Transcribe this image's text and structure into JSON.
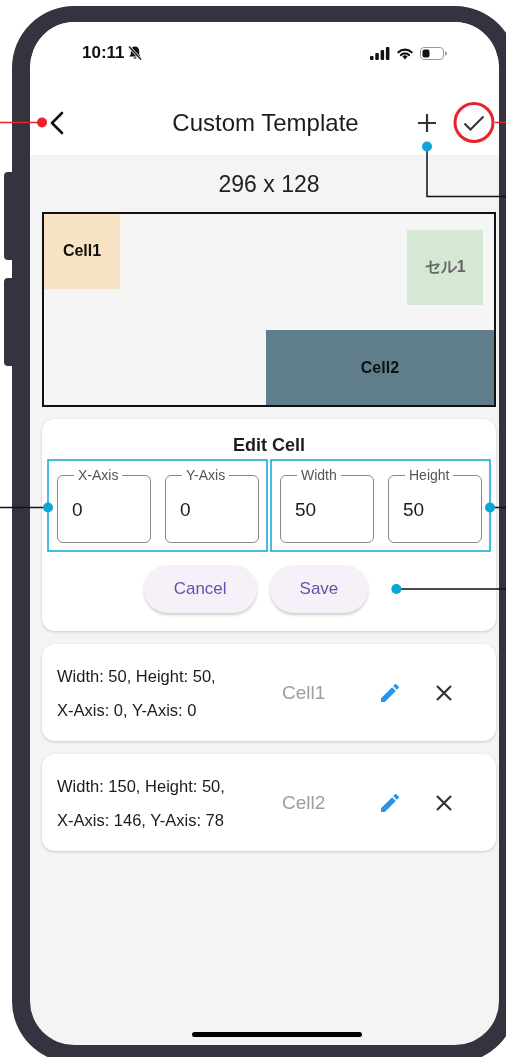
{
  "status_bar": {
    "time": "10:11",
    "silent": true
  },
  "app_bar": {
    "title": "Custom Template",
    "back": {
      "callout": {
        "kind": "dot-left",
        "color": "#e8232b"
      }
    },
    "add": {
      "callout": {
        "kind": "dot-below-elbow",
        "color": "#0ba5d8"
      }
    },
    "done": {
      "callout": {
        "kind": "ring-right",
        "color": "#e8232b"
      }
    }
  },
  "canvas": {
    "size_label": "296 x 128",
    "cells": [
      {
        "label": "Cell1",
        "color": "#f8e3c5"
      },
      {
        "label": "セル1",
        "color": "#d5e8d4"
      },
      {
        "label": "Cell2",
        "color": "#607d8b"
      }
    ]
  },
  "edit_card": {
    "title": "Edit Cell",
    "field_groups": [
      {
        "callout": {
          "kind": "frame-left",
          "color": "#0ba5d8"
        },
        "fields": [
          {
            "label": "X-Axis",
            "value": "0"
          },
          {
            "label": "Y-Axis",
            "value": "0"
          }
        ]
      },
      {
        "callout": {
          "kind": "frame-right",
          "color": "#0ba5d8"
        },
        "fields": [
          {
            "label": "Width",
            "value": "50"
          },
          {
            "label": "Height",
            "value": "50"
          }
        ]
      }
    ],
    "buttons": [
      {
        "label": "Cancel"
      },
      {
        "label": "Save"
      }
    ],
    "actions_callout": {
      "kind": "dot-right",
      "color": "#0ba5d8"
    }
  },
  "cell_list": [
    {
      "details": [
        "Width: 50, Height: 50,",
        "X-Axis: 0, Y-Axis: 0"
      ],
      "name": "Cell1"
    },
    {
      "details": [
        "Width: 150, Height: 50,",
        "X-Axis: 146, Y-Axis: 78"
      ],
      "name": "Cell2"
    }
  ]
}
